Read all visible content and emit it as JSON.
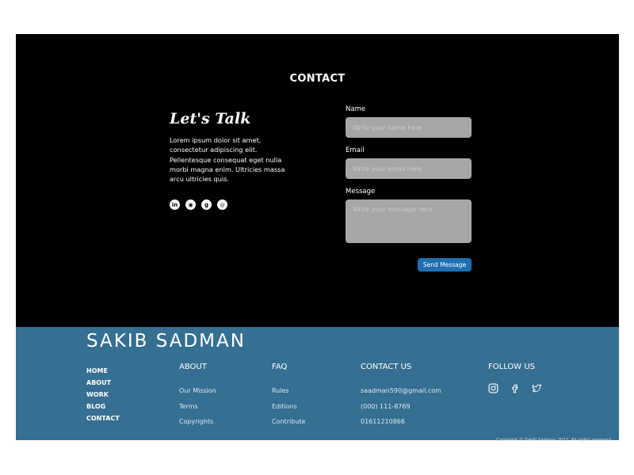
{
  "contact": {
    "heading": "CONTACT",
    "talk_title": "Let's Talk",
    "talk_text": "Lorem ipsum dolor sit amet, consectetur adipiscing elit. Pellentesque consequat eget nulla morbi magna enim. Ultricies massa arcu ultricies quis.",
    "socials": [
      {
        "icon": "linkedin-icon",
        "glyph": "in"
      },
      {
        "icon": "github-icon",
        "glyph": "◉"
      },
      {
        "icon": "google-plus-icon",
        "glyph": "g"
      },
      {
        "icon": "instagram-icon",
        "glyph": "◎"
      }
    ],
    "form": {
      "name_label": "Name",
      "name_placeholder": "Write your name here",
      "email_label": "Email",
      "email_placeholder": "Write your email here",
      "message_label": "Message",
      "message_placeholder": "Write your message here",
      "send_label": "Send Message"
    }
  },
  "footer": {
    "brand": "SAKIB SADMAN",
    "nav": [
      "HOME",
      "ABOUT",
      "WORK",
      "BLOG",
      "CONTACT"
    ],
    "about": {
      "heading": "ABOUT",
      "items": [
        "Our Mission",
        "Terms",
        "Copyrights"
      ]
    },
    "faq": {
      "heading": "FAQ",
      "items": [
        "Rules",
        "Editions",
        "Contribute"
      ]
    },
    "contact_us": {
      "heading": "CONTACT US",
      "items": [
        "saadman590@gmail.com",
        "(000) 111-8769",
        "01611210866"
      ]
    },
    "follow": {
      "heading": "FOLLOW US",
      "icons": [
        "instagram-icon",
        "facebook-icon",
        "twitter-icon"
      ]
    },
    "copyright": "Copyright © Sakib Sadman 2022. All rights reserved"
  },
  "colors": {
    "contact_bg": "#000000",
    "footer_bg": "#356f91",
    "field_bg": "#a6a6a6",
    "button_bg": "#1f6fb2"
  }
}
